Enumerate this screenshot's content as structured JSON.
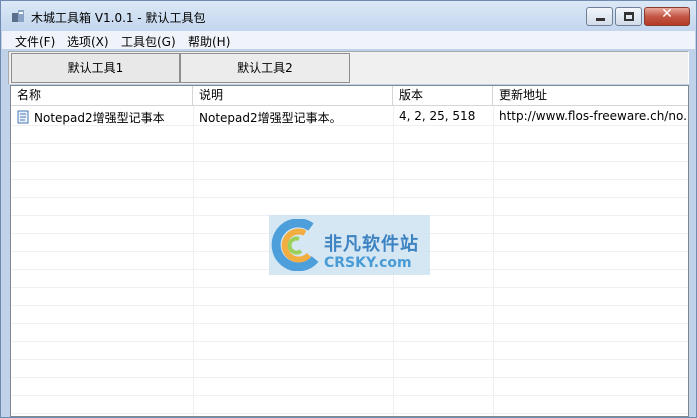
{
  "window": {
    "title": "木城工具箱 V1.0.1 - 默认工具包",
    "close_glyph": "✕"
  },
  "menubar": {
    "items": [
      "文件(F)",
      "选项(X)",
      "工具包(G)",
      "帮助(H)"
    ]
  },
  "tabs": [
    {
      "label": "默认工具1",
      "selected": true
    },
    {
      "label": "默认工具2",
      "selected": false
    }
  ],
  "list": {
    "columns": [
      "名称",
      "说明",
      "版本",
      "更新地址"
    ],
    "rows": [
      {
        "icon": "notepad-icon",
        "name": "Notepad2增强型记事本",
        "description": "Notepad2增强型记事本。",
        "version": "4, 2, 25, 518",
        "update_url": "http://www.flos-freeware.ch/no..."
      }
    ]
  },
  "watermark": {
    "cn_text": "非凡软件站",
    "en_text": "CRSKY.com"
  },
  "colors": {
    "title_bar": "#c3d6ee",
    "close_button": "#c45645",
    "watermark_blue": "#1c6eb8"
  }
}
